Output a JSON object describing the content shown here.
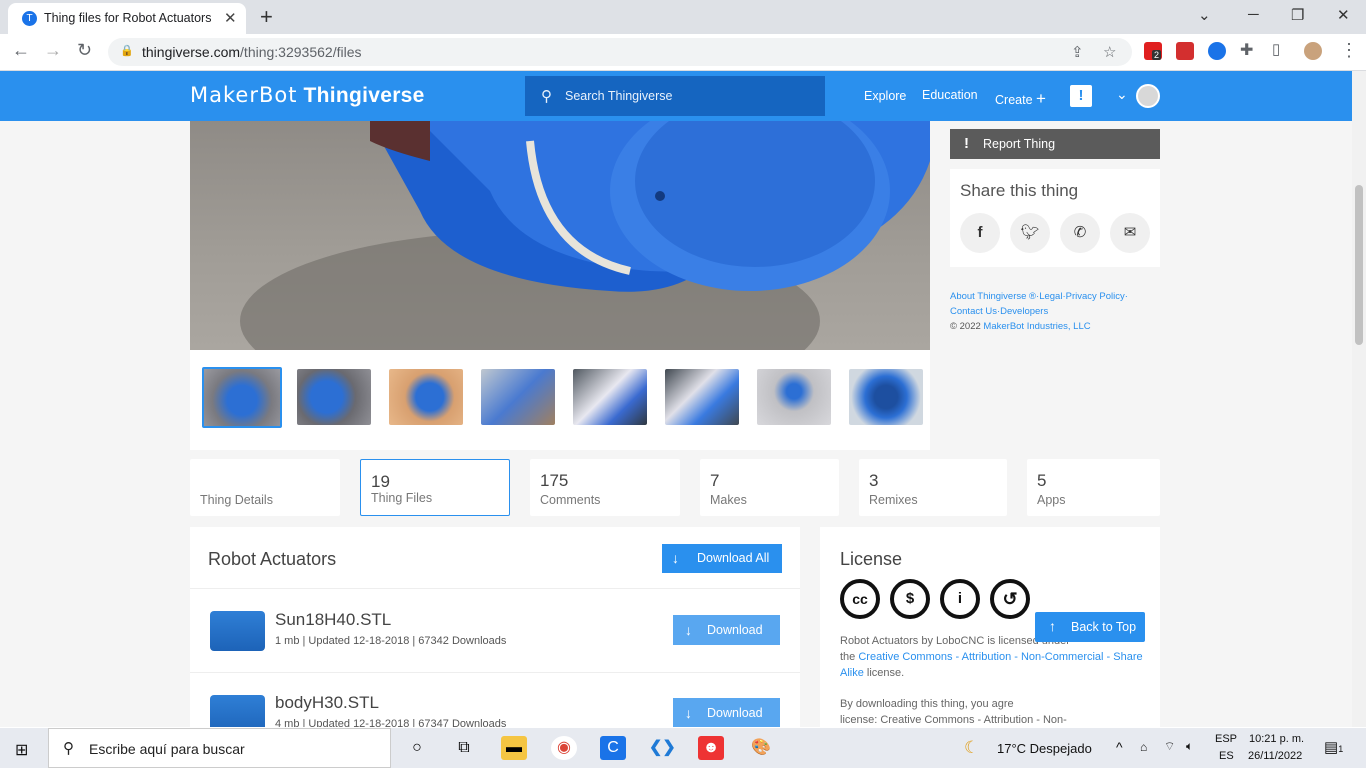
{
  "browser": {
    "tab_title": "Thing files for Robot Actuators by",
    "tab_favicon": "T",
    "new_tab": "+",
    "url_host": "thingiverse.com",
    "url_path": "/thing:3293562/files",
    "ext_badge": "2"
  },
  "header": {
    "logo_prefix": "MakerBot",
    "logo_name": "Thingiverse",
    "search_placeholder": "Search Thingiverse",
    "nav": [
      "Explore",
      "Education",
      "Create"
    ],
    "alert": "!"
  },
  "sidebar": {
    "report_label": "Report Thing",
    "share_title": "Share this thing",
    "footer_line1": "About Thingiverse ®·Legal·Privacy Policy·",
    "footer_line2": "Contact Us·Developers",
    "footer_copy": "©  2022 ",
    "footer_company": "MakerBot Industries, LLC"
  },
  "stats": [
    {
      "number": "",
      "label": "Thing Details"
    },
    {
      "number": "19",
      "label": "Thing Files"
    },
    {
      "number": "175",
      "label": "Comments"
    },
    {
      "number": "7",
      "label": "Makes"
    },
    {
      "number": "3",
      "label": "Remixes"
    },
    {
      "number": "5",
      "label": "Apps"
    }
  ],
  "files": {
    "title": "Robot Actuators",
    "download_all": "Download All",
    "items": [
      {
        "name": "Sun18H40.STL",
        "meta": "1 mb | Updated 12-18-2018 | 67342 Downloads",
        "download": "Download"
      },
      {
        "name": "bodyH30.STL",
        "meta": "4 mb | Updated 12-18-2018 | 67347 Downloads",
        "download": "Download"
      }
    ]
  },
  "license": {
    "title": "License",
    "icons": [
      "cc",
      "$",
      "i",
      "↺"
    ],
    "text_a": "Robot Actuators by  LoboCNC  is licensed under",
    "text_b": "the  ",
    "link": "Creative Commons - Attribution - Non-Commercial - Share Alike",
    "text_c": "  license.",
    "text_d": "By downloading this thing, you agre",
    "text_e": "license: Creative Commons - Attribution - Non-"
  },
  "back_to_top": "Back to Top",
  "taskbar": {
    "search_placeholder": "Escribe aquí para buscar",
    "weather": "17°C  Despejado",
    "lang1": "ESP",
    "lang2": "ES",
    "time": "10:21 p. m.",
    "date": "26/11/2022",
    "notif": "1"
  },
  "colors": {
    "brand": "#2a90ee",
    "search": "#1565c0"
  }
}
